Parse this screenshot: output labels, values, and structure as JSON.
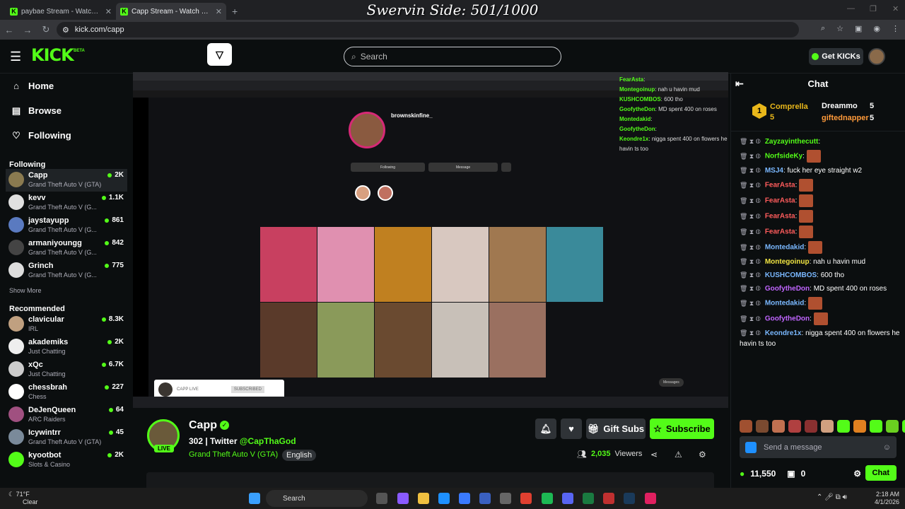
{
  "browser": {
    "tabs": [
      {
        "title": "paybae Stream - Watch Live on K",
        "active": false
      },
      {
        "title": "Capp Stream - Watch Live on Ki",
        "active": true
      }
    ],
    "url": "kick.com/capp"
  },
  "overlay_text": "Swervin Side: 501/1000",
  "header": {
    "logo": "KICK",
    "beta": "BETA",
    "search_placeholder": "Search",
    "get_kicks": "Get KICKs"
  },
  "sidebar": {
    "nav": [
      {
        "label": "Home",
        "icon": "home-icon"
      },
      {
        "label": "Browse",
        "icon": "browse-icon"
      },
      {
        "label": "Following",
        "icon": "heart-icon"
      }
    ],
    "following_title": "Following",
    "following": [
      {
        "name": "Capp",
        "game": "Grand Theft Auto V (GTA)",
        "viewers": "2K",
        "color": "#8a7a50"
      },
      {
        "name": "kevv",
        "game": "Grand Theft Auto V (G...",
        "viewers": "1.1K",
        "color": "#e0e0e0"
      },
      {
        "name": "jaystayupp",
        "game": "Grand Theft Auto V (G...",
        "viewers": "861",
        "color": "#5a7ac0"
      },
      {
        "name": "armaniyoungg",
        "game": "Grand Theft Auto V (G...",
        "viewers": "842",
        "color": "#444"
      },
      {
        "name": "Grinch",
        "game": "Grand Theft Auto V (G...",
        "viewers": "775",
        "color": "#ddd"
      }
    ],
    "show_more": "Show More",
    "recommended_title": "Recommended",
    "recommended": [
      {
        "name": "clavicular",
        "game": "IRL",
        "viewers": "8.3K",
        "color": "#c0a080"
      },
      {
        "name": "akademiks",
        "game": "Just Chatting",
        "viewers": "2K",
        "color": "#eee"
      },
      {
        "name": "xQc",
        "game": "Just Chatting",
        "viewers": "6.7K",
        "color": "#ccc"
      },
      {
        "name": "chessbrah",
        "game": "Chess",
        "viewers": "227",
        "color": "#fff"
      },
      {
        "name": "DeJenQueen",
        "game": "ARC Raiders",
        "viewers": "64",
        "color": "#a05080"
      },
      {
        "name": "Icywintrr",
        "game": "Grand Theft Auto V (GTA)",
        "viewers": "45",
        "color": "#7a8a9a"
      },
      {
        "name": "kyootbot",
        "game": "Slots & Casino",
        "viewers": "2K",
        "color": "#53fc18"
      }
    ]
  },
  "video": {
    "ig_username": "brownskinfine_",
    "follow_button": "Following",
    "message_button": "Message",
    "notify_name": "CAPP LIVE",
    "notify_btn": "SUBSCRIBED",
    "messages_label": "Messages",
    "overlay_chat": [
      {
        "user": "FearAsta",
        "text": ""
      },
      {
        "user": "Montegoinup",
        "text": "nah u havin mud"
      },
      {
        "user": "KUSHCOMBOS",
        "text": "600 tho"
      },
      {
        "user": "GoofytheDon",
        "text": "MD spent 400 on roses"
      },
      {
        "user": "Montedakid",
        "text": ""
      },
      {
        "user": "GoofytheDon",
        "text": ""
      },
      {
        "user": "Keondre1x",
        "text": "nigga spent 400 on flowers he havin ts too"
      }
    ]
  },
  "channel": {
    "name": "Capp",
    "live": "LIVE",
    "title_prefix": "302 | Twitter",
    "title_handle": "@CapThaGod",
    "game": "Grand Theft Auto V (GTA)",
    "language": "English",
    "gift_subs": "Gift Subs",
    "subscribe": "Subscribe",
    "viewers_count": "2,035",
    "viewers_label": "Viewers"
  },
  "chat": {
    "title": "Chat",
    "leaderboard": [
      {
        "rank": "1",
        "name": "Comprella",
        "count": "5"
      },
      {
        "name": "Dreammo",
        "count": "5"
      },
      {
        "name": "giftednapper",
        "count": "5"
      }
    ],
    "messages": [
      {
        "user": "Zayzayinthecutt",
        "color": "#53fc18",
        "text": "",
        "emote": false
      },
      {
        "user": "NorfsideKy",
        "color": "#53fc18",
        "text": "",
        "emote": true
      },
      {
        "user": "MSJ4",
        "color": "#7ab8ff",
        "text": "fuck her eye straight w2",
        "emote": false
      },
      {
        "user": "FearAsta",
        "color": "#ff5c5c",
        "text": "",
        "emote": true
      },
      {
        "user": "FearAsta",
        "color": "#ff5c5c",
        "text": "",
        "emote": true
      },
      {
        "user": "FearAsta",
        "color": "#ff5c5c",
        "text": "",
        "emote": true
      },
      {
        "user": "FearAsta",
        "color": "#ff5c5c",
        "text": "",
        "emote": true
      },
      {
        "user": "Montedakid",
        "color": "#7ab8ff",
        "text": "",
        "emote": true
      },
      {
        "user": "Montegoinup",
        "color": "#f0e442",
        "text": "nah u havin mud",
        "emote": false
      },
      {
        "user": "KUSHCOMBOS",
        "color": "#7ab8ff",
        "text": "600 tho",
        "emote": false
      },
      {
        "user": "GoofytheDon",
        "color": "#c065ff",
        "text": "MD spent 400 on roses",
        "emote": false
      },
      {
        "user": "Montedakid",
        "color": "#7ab8ff",
        "text": "",
        "emote": true
      },
      {
        "user": "GoofytheDon",
        "color": "#c065ff",
        "text": "",
        "emote": true
      },
      {
        "user": "Keondre1x",
        "color": "#7ab8ff",
        "text": "nigga spent 400 on flowers he havin ts too",
        "emote": false
      }
    ],
    "send_placeholder": "Send a message",
    "kicks_balance": "11,550",
    "points": "0",
    "chat_button": "Chat"
  },
  "taskbar": {
    "temp": "71°F",
    "weather": "Clear",
    "search": "Search",
    "time": "2:18 AM",
    "date": "4/1/2026"
  }
}
